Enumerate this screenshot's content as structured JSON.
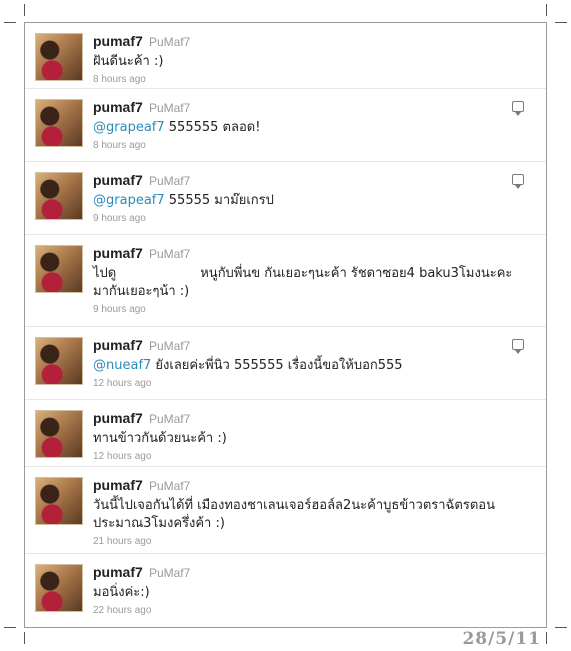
{
  "tweets": [
    {
      "username": "pumaf7",
      "fullname": "PuMaf7",
      "mention": "",
      "text": "ฝันดีนะค้า :)",
      "time": "8 hours ago",
      "reply": false
    },
    {
      "username": "pumaf7",
      "fullname": "PuMaf7",
      "mention": "@grapeaf7",
      "text": " 555555 ตลอด!",
      "time": "8 hours ago",
      "reply": true
    },
    {
      "username": "pumaf7",
      "fullname": "PuMaf7",
      "mention": "@grapeaf7",
      "text": " 55555 มาม๊ยเกรป",
      "time": "9 hours ago",
      "reply": true
    },
    {
      "username": "pumaf7",
      "fullname": "PuMaf7",
      "mention": "",
      "text_prefix": "ไปดู",
      "text": "หนูกับพี่นข กันเยอะๆนะค้า รัชดาซอย4 baku3โมงนะคะ มากันเยอะๆน้า :)",
      "time": "9 hours ago",
      "reply": false
    },
    {
      "username": "pumaf7",
      "fullname": "PuMaf7",
      "mention": "@nueaf7",
      "text": " ยังเลยค่ะพี่นิว 555555 เรื่องนี้ขอให้บอก555",
      "time": "12 hours ago",
      "reply": true
    },
    {
      "username": "pumaf7",
      "fullname": "PuMaf7",
      "mention": "",
      "text": "ทานข้าวกันด้วยนะค้า :)",
      "time": "12 hours ago",
      "reply": false
    },
    {
      "username": "pumaf7",
      "fullname": "PuMaf7",
      "mention": "",
      "text": "วันนี้ไปเจอกันได้ที่ เมืองทองชาเลนเจอร์ฮอล์ล2นะค้าบูธข้าวตราฉัตรตอน ประมาณ3โมงครึ่งค้า :)",
      "time": "21 hours ago",
      "reply": false
    },
    {
      "username": "pumaf7",
      "fullname": "PuMaf7",
      "mention": "",
      "text": "มอนิ่งค่ะ:)",
      "time": "22 hours ago",
      "reply": false
    }
  ],
  "stamp": "28/5/11"
}
